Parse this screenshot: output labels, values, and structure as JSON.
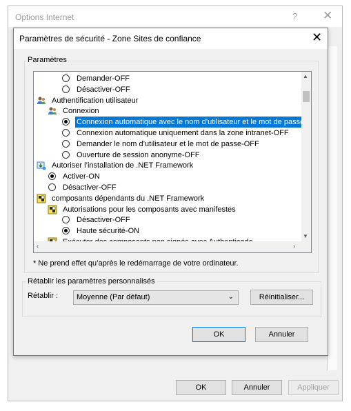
{
  "outer": {
    "title": "Options Internet",
    "help_glyph": "?",
    "close_glyph": "✕",
    "buttons": {
      "ok": "OK",
      "cancel": "Annuler",
      "apply": "Appliquer"
    }
  },
  "dialog": {
    "title": "Paramètres de sécurité - Zone Sites de confiance",
    "close_glyph": "✕",
    "settings_group": "Paramètres",
    "tree": [
      {
        "type": "radio",
        "indent": 2,
        "label": "Demander-OFF",
        "checked": false
      },
      {
        "type": "radio",
        "indent": 2,
        "label": "Désactiver-OFF",
        "checked": false
      },
      {
        "type": "icon",
        "icon": "users-icon",
        "indent": 0,
        "label": "Authentification utilisateur"
      },
      {
        "type": "icon",
        "icon": "users-icon",
        "indent": 1,
        "label": "Connexion"
      },
      {
        "type": "radio",
        "indent": 2,
        "label": "Connexion automatique avec le nom d’utilisateur et le mot de passe",
        "checked": true,
        "selected": true
      },
      {
        "type": "radio",
        "indent": 2,
        "label": "Connexion automatique uniquement dans la zone intranet-OFF",
        "checked": false
      },
      {
        "type": "radio",
        "indent": 2,
        "label": "Demander le nom d’utilisateur et le mot de passe-OFF",
        "checked": false
      },
      {
        "type": "radio",
        "indent": 2,
        "label": "Ouverture de session anonyme-OFF",
        "checked": false
      },
      {
        "type": "icon",
        "icon": "install-icon",
        "indent": 0,
        "label": "Autoriser l’installation de .NET Framework"
      },
      {
        "type": "radio",
        "indent": 1,
        "label": "Activer-ON",
        "checked": true
      },
      {
        "type": "radio",
        "indent": 1,
        "label": "Désactiver-OFF",
        "checked": false
      },
      {
        "type": "icon",
        "icon": "components-icon",
        "indent": 0,
        "label": "composants dépendants du .NET Framework"
      },
      {
        "type": "icon",
        "icon": "components-icon",
        "indent": 1,
        "label": "Autorisations pour les composants avec manifestes"
      },
      {
        "type": "radio",
        "indent": 2,
        "label": "Désactiver-OFF",
        "checked": false
      },
      {
        "type": "radio",
        "indent": 2,
        "label": "Haute sécurité-ON",
        "checked": true
      },
      {
        "type": "icon",
        "icon": "components-icon",
        "indent": 1,
        "label": "Exécuter des composants non signés avec Authenticode"
      }
    ],
    "note": "* Ne prend effet qu’après le redémarrage de votre ordinateur.",
    "reset_group": "Rétablir les paramètres personnalisés",
    "reset_label": "Rétablir :",
    "reset_value": "Moyenne (Par défaut)",
    "reset_button": "Réinitialiser...",
    "ok": "OK",
    "cancel": "Annuler"
  },
  "colors": {
    "selection": "#0078d7",
    "window_bg": "#f0f0f0"
  }
}
